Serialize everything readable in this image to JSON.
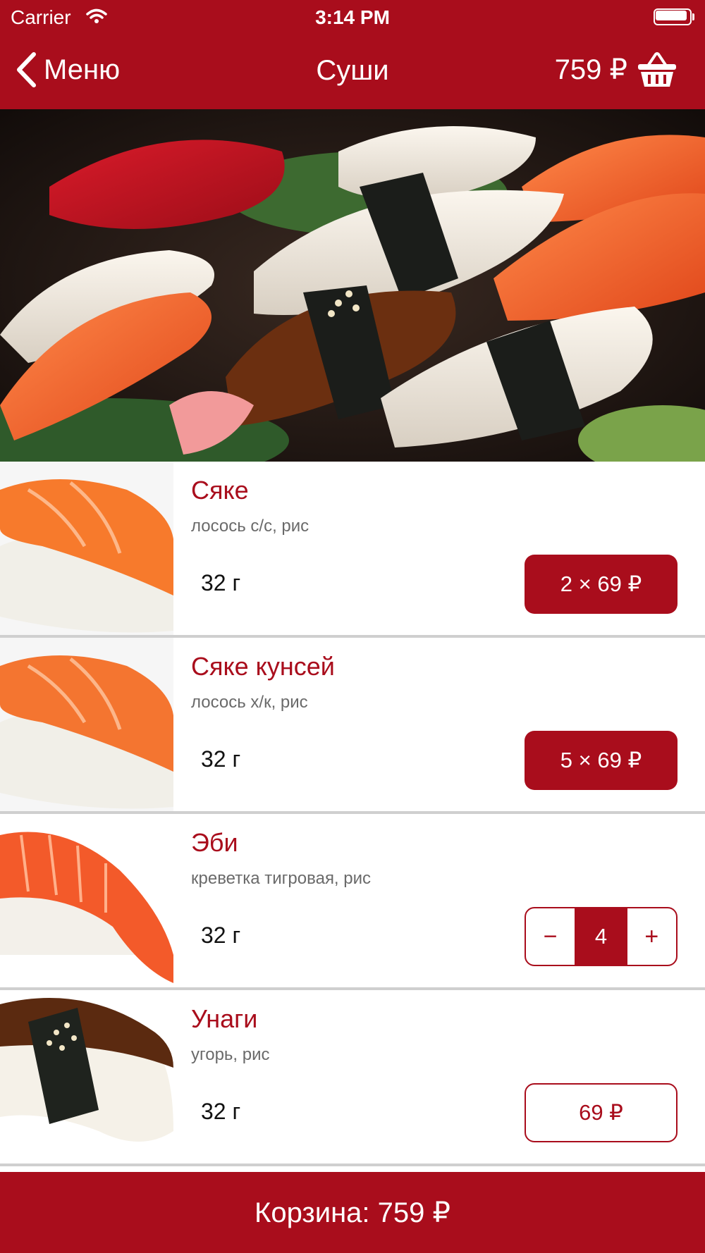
{
  "status_bar": {
    "carrier": "Carrier",
    "time": "3:14 PM"
  },
  "nav": {
    "back_label": "Меню",
    "title": "Суши",
    "cart_total": "759 ₽"
  },
  "items": [
    {
      "title": "Сяке",
      "desc": "лосось с/с, рис",
      "weight": "32 г",
      "button": "2 × 69 ₽"
    },
    {
      "title": "Сяке кунсей",
      "desc": "лосось х/к, рис",
      "weight": "32 г",
      "button": "5 × 69 ₽"
    },
    {
      "title": "Эби",
      "desc": "креветка тигровая, рис",
      "weight": "32 г",
      "stepper": {
        "minus": "−",
        "count": "4",
        "plus": "+"
      }
    },
    {
      "title": "Унаги",
      "desc": "угорь, рис",
      "weight": "32 г",
      "button": "69 ₽"
    }
  ],
  "footer": {
    "label": "Корзина: 759 ₽"
  },
  "colors": {
    "brand": "#a90d1c",
    "divider": "#cfcfcf",
    "desc_text": "#6a6a6a"
  }
}
